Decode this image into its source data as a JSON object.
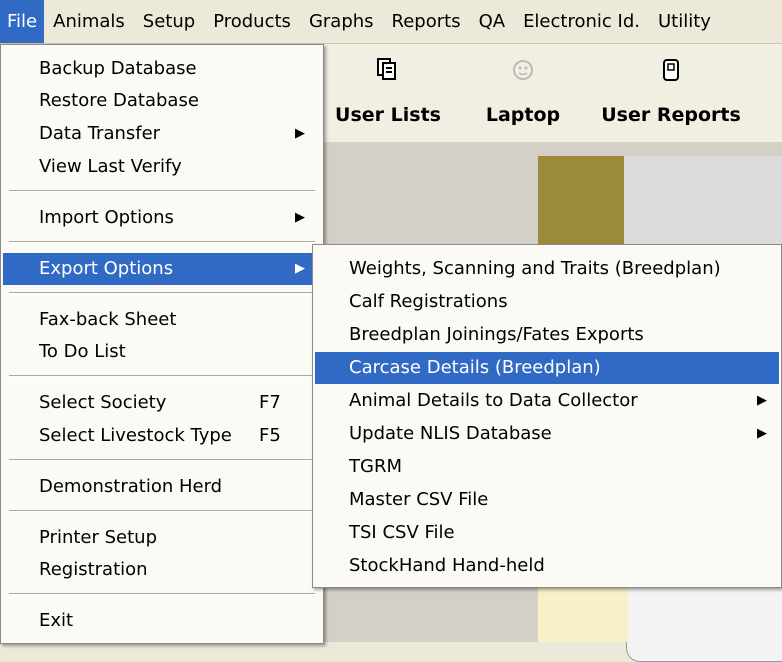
{
  "menubar": {
    "items": [
      {
        "label": "File",
        "active": true
      },
      {
        "label": "Animals",
        "active": false
      },
      {
        "label": "Setup",
        "active": false
      },
      {
        "label": "Products",
        "active": false
      },
      {
        "label": "Graphs",
        "active": false
      },
      {
        "label": "Reports",
        "active": false
      },
      {
        "label": "QA",
        "active": false
      },
      {
        "label": "Electronic Id.",
        "active": false
      },
      {
        "label": "Utility",
        "active": false
      }
    ]
  },
  "toolbar": {
    "buttons": [
      {
        "label": "User Lists",
        "icon": "copy-icon"
      },
      {
        "label": "Laptop",
        "icon": "smiley-icon"
      },
      {
        "label": "User Reports",
        "icon": "report-icon"
      }
    ]
  },
  "file_menu": {
    "items": [
      {
        "label": "Backup Database"
      },
      {
        "label": "Restore Database"
      },
      {
        "label": "Data Transfer",
        "submenu": true
      },
      {
        "label": "View Last Verify"
      },
      {
        "label": "Import Options",
        "submenu": true
      },
      {
        "label": "Export Options",
        "submenu": true,
        "highlighted": true
      },
      {
        "label": "Fax-back Sheet"
      },
      {
        "label": "To Do List"
      },
      {
        "label": "Select Society",
        "shortcut": "F7"
      },
      {
        "label": "Select Livestock Type",
        "shortcut": "F5"
      },
      {
        "label": "Demonstration Herd"
      },
      {
        "label": "Printer Setup"
      },
      {
        "label": "Registration"
      },
      {
        "label": "Exit"
      }
    ]
  },
  "export_submenu": {
    "items": [
      {
        "label": "Weights, Scanning and Traits (Breedplan)"
      },
      {
        "label": "Calf Registrations"
      },
      {
        "label": "Breedplan Joinings/Fates Exports"
      },
      {
        "label": "Carcase Details (Breedplan)",
        "highlighted": true
      },
      {
        "label": "Animal Details to Data Collector",
        "submenu": true
      },
      {
        "label": "Update NLIS Database",
        "submenu": true
      },
      {
        "label": "TGRM"
      },
      {
        "label": "Master CSV File"
      },
      {
        "label": "TSI CSV File"
      },
      {
        "label": "StockHand Hand-held"
      }
    ]
  },
  "colors": {
    "highlight": "#316ac5",
    "menu_bg": "#fbfaf5"
  }
}
